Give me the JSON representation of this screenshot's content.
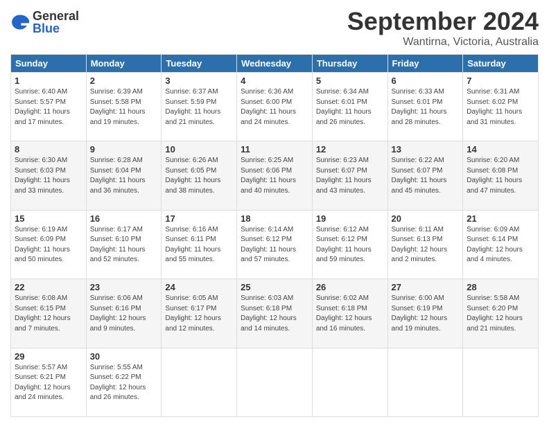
{
  "header": {
    "logo_general": "General",
    "logo_blue": "Blue",
    "title": "September 2024",
    "location": "Wantirna, Victoria, Australia"
  },
  "weekdays": [
    "Sunday",
    "Monday",
    "Tuesday",
    "Wednesday",
    "Thursday",
    "Friday",
    "Saturday"
  ],
  "weeks": [
    [
      {
        "day": 1,
        "sunrise": "6:40 AM",
        "sunset": "5:57 PM",
        "daylight": "11 hours and 17 minutes."
      },
      {
        "day": 2,
        "sunrise": "6:39 AM",
        "sunset": "5:58 PM",
        "daylight": "11 hours and 19 minutes."
      },
      {
        "day": 3,
        "sunrise": "6:37 AM",
        "sunset": "5:59 PM",
        "daylight": "11 hours and 21 minutes."
      },
      {
        "day": 4,
        "sunrise": "6:36 AM",
        "sunset": "6:00 PM",
        "daylight": "11 hours and 24 minutes."
      },
      {
        "day": 5,
        "sunrise": "6:34 AM",
        "sunset": "6:01 PM",
        "daylight": "11 hours and 26 minutes."
      },
      {
        "day": 6,
        "sunrise": "6:33 AM",
        "sunset": "6:01 PM",
        "daylight": "11 hours and 28 minutes."
      },
      {
        "day": 7,
        "sunrise": "6:31 AM",
        "sunset": "6:02 PM",
        "daylight": "11 hours and 31 minutes."
      }
    ],
    [
      {
        "day": 8,
        "sunrise": "6:30 AM",
        "sunset": "6:03 PM",
        "daylight": "11 hours and 33 minutes."
      },
      {
        "day": 9,
        "sunrise": "6:28 AM",
        "sunset": "6:04 PM",
        "daylight": "11 hours and 36 minutes."
      },
      {
        "day": 10,
        "sunrise": "6:26 AM",
        "sunset": "6:05 PM",
        "daylight": "11 hours and 38 minutes."
      },
      {
        "day": 11,
        "sunrise": "6:25 AM",
        "sunset": "6:06 PM",
        "daylight": "11 hours and 40 minutes."
      },
      {
        "day": 12,
        "sunrise": "6:23 AM",
        "sunset": "6:07 PM",
        "daylight": "11 hours and 43 minutes."
      },
      {
        "day": 13,
        "sunrise": "6:22 AM",
        "sunset": "6:07 PM",
        "daylight": "11 hours and 45 minutes."
      },
      {
        "day": 14,
        "sunrise": "6:20 AM",
        "sunset": "6:08 PM",
        "daylight": "11 hours and 47 minutes."
      }
    ],
    [
      {
        "day": 15,
        "sunrise": "6:19 AM",
        "sunset": "6:09 PM",
        "daylight": "11 hours and 50 minutes."
      },
      {
        "day": 16,
        "sunrise": "6:17 AM",
        "sunset": "6:10 PM",
        "daylight": "11 hours and 52 minutes."
      },
      {
        "day": 17,
        "sunrise": "6:16 AM",
        "sunset": "6:11 PM",
        "daylight": "11 hours and 55 minutes."
      },
      {
        "day": 18,
        "sunrise": "6:14 AM",
        "sunset": "6:12 PM",
        "daylight": "11 hours and 57 minutes."
      },
      {
        "day": 19,
        "sunrise": "6:12 AM",
        "sunset": "6:12 PM",
        "daylight": "11 hours and 59 minutes."
      },
      {
        "day": 20,
        "sunrise": "6:11 AM",
        "sunset": "6:13 PM",
        "daylight": "12 hours and 2 minutes."
      },
      {
        "day": 21,
        "sunrise": "6:09 AM",
        "sunset": "6:14 PM",
        "daylight": "12 hours and 4 minutes."
      }
    ],
    [
      {
        "day": 22,
        "sunrise": "6:08 AM",
        "sunset": "6:15 PM",
        "daylight": "12 hours and 7 minutes."
      },
      {
        "day": 23,
        "sunrise": "6:06 AM",
        "sunset": "6:16 PM",
        "daylight": "12 hours and 9 minutes."
      },
      {
        "day": 24,
        "sunrise": "6:05 AM",
        "sunset": "6:17 PM",
        "daylight": "12 hours and 12 minutes."
      },
      {
        "day": 25,
        "sunrise": "6:03 AM",
        "sunset": "6:18 PM",
        "daylight": "12 hours and 14 minutes."
      },
      {
        "day": 26,
        "sunrise": "6:02 AM",
        "sunset": "6:18 PM",
        "daylight": "12 hours and 16 minutes."
      },
      {
        "day": 27,
        "sunrise": "6:00 AM",
        "sunset": "6:19 PM",
        "daylight": "12 hours and 19 minutes."
      },
      {
        "day": 28,
        "sunrise": "5:58 AM",
        "sunset": "6:20 PM",
        "daylight": "12 hours and 21 minutes."
      }
    ],
    [
      {
        "day": 29,
        "sunrise": "5:57 AM",
        "sunset": "6:21 PM",
        "daylight": "12 hours and 24 minutes."
      },
      {
        "day": 30,
        "sunrise": "5:55 AM",
        "sunset": "6:22 PM",
        "daylight": "12 hours and 26 minutes."
      },
      null,
      null,
      null,
      null,
      null
    ]
  ]
}
